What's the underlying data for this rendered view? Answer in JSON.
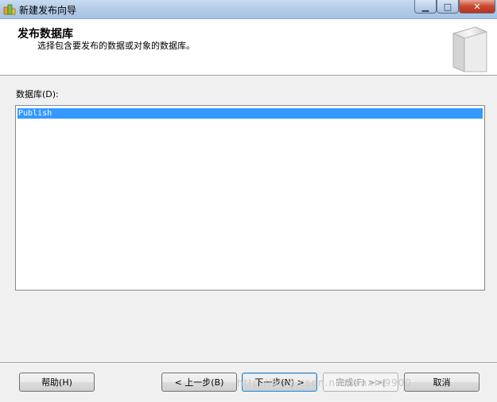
{
  "window": {
    "title": "新建发布向导",
    "controls": [
      "minimize",
      "maximize",
      "close"
    ]
  },
  "header": {
    "title": "发布数据库",
    "subtitle": "选择包含要发布的数据或对象的数据库。",
    "image_icon": "book-graphic-icon"
  },
  "database_list": {
    "label": "数据库(D):",
    "items": [
      {
        "name": "Publish",
        "selected": true
      }
    ]
  },
  "buttons": {
    "help": "帮助(H)",
    "back": "< 上一步(B)",
    "next": "下一步(N) >",
    "finish": "完成(F) >>|",
    "cancel": "取消"
  },
  "watermark": "http://blog.csdn.net/lanxin9900"
}
